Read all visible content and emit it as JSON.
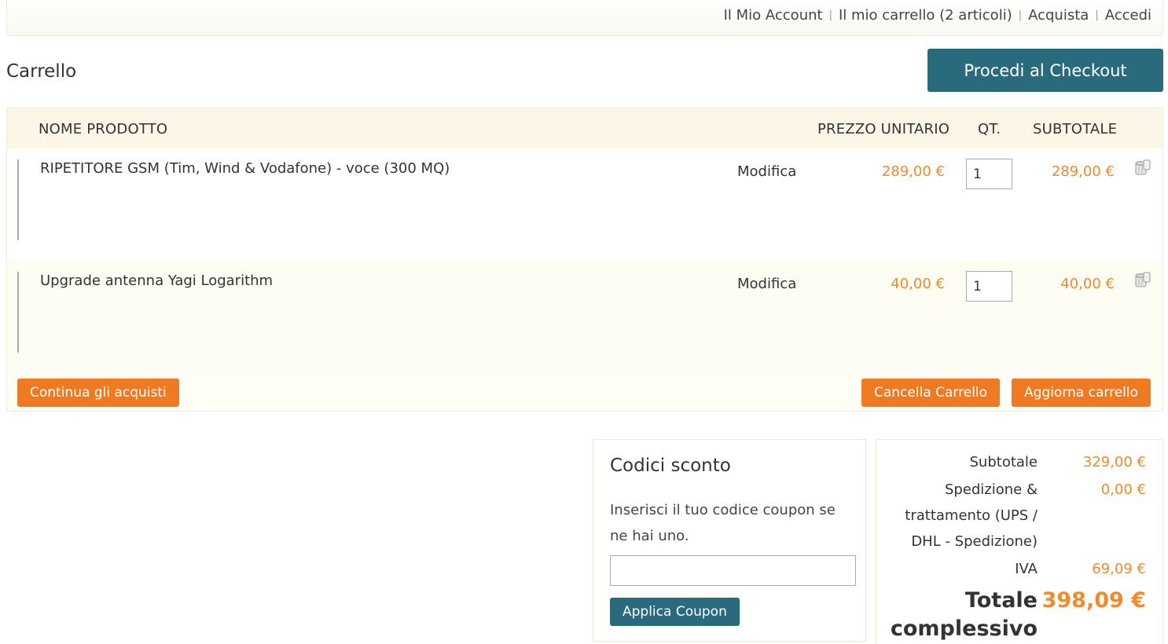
{
  "header": {
    "links": [
      "Il Mio Account",
      "Il mio carrello (2 articoli)",
      "Acquista",
      "Accedi"
    ]
  },
  "page": {
    "title": "Carrello",
    "checkout_label": "Procedi al Checkout"
  },
  "cart": {
    "columns": {
      "name": "NOME PRODOTTO",
      "unit_price": "PREZZO UNITARIO",
      "qty": "QT.",
      "subtotal": "SUBTOTALE"
    },
    "items": [
      {
        "name": "RIPETITORE GSM (Tim, Wind & Vodafone) - voce (300 MQ)",
        "edit_label": "Modifica",
        "price": "289,00 €",
        "qty": "1",
        "subtotal": "289,00 €"
      },
      {
        "name": "Upgrade antenna Yagi Logarithm",
        "edit_label": "Modifica",
        "price": "40,00 €",
        "qty": "1",
        "subtotal": "40,00 €"
      }
    ],
    "continue_label": "Continua gli acquisti",
    "clear_label": "Cancella Carrello",
    "update_label": "Aggiorna carrello"
  },
  "coupon": {
    "title": "Codici sconto",
    "description": "Inserisci il tuo codice coupon se ne hai uno.",
    "input_value": "",
    "apply_label": "Applica Coupon"
  },
  "totals": {
    "subtotal_label": "Subtotale",
    "subtotal_value": "329,00 €",
    "shipping_label": "Spedizione & trattamento (UPS / DHL - Spedizione)",
    "shipping_value": "0,00 €",
    "tax_label": "IVA",
    "tax_value": "69,09 €",
    "grand_label": "Totale complessivo",
    "grand_value": "398,09 €"
  },
  "colors": {
    "accent_orange": "#f07a22",
    "price_orange": "#f08a2c",
    "teal": "#296b7c"
  },
  "icons": {
    "remove": "trash-can-icon"
  }
}
